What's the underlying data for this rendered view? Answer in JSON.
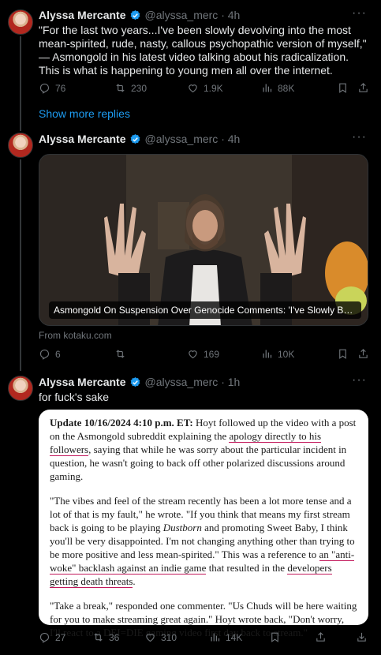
{
  "tweets": [
    {
      "author": "Alyssa Mercante",
      "handle": "@alyssa_merc",
      "time": "4h",
      "text": "\"For the last two years...I've been slowly devolving into the most mean-spirited, rude, nasty, callous psychopathic version of myself,\" — Asmongold in his latest video talking about his radicalization. This is what is happening to young men all over the internet.",
      "replies": "76",
      "reposts": "230",
      "likes": "1.9K",
      "views": "88K"
    },
    {
      "author": "Alyssa Mercante",
      "handle": "@alyssa_merc",
      "time": "4h",
      "media_caption": "Asmongold On Suspension Over Genocide Comments: 'I've Slowly Been Devolving...",
      "source": "From kotaku.com",
      "replies": "6",
      "reposts": "",
      "likes": "169",
      "views": "10K"
    },
    {
      "author": "Alyssa Mercante",
      "handle": "@alyssa_merc",
      "time": "1h",
      "text": "for fuck's sake",
      "replies": "27",
      "reposts": "36",
      "likes": "310",
      "views": "14K"
    }
  ],
  "show_more": "Show more replies",
  "article": {
    "p1_bold": "Update 10/16/2024 4:10 p.m. ET:",
    "p1_a": " Hoyt followed up the video with a post on the Asmongold subreddit explaining the ",
    "p1_link": "apology directly to his followers",
    "p1_b": ", saying that while he was sorry about the particular incident in question, he wasn't going to back off other polarized discussions around gaming.",
    "p2_a": "\"The vibes and feel of the stream recently has been a lot more tense and a lot of that is my fault,\" he wrote. \"If you think that means my first stream back is going to be playing ",
    "p2_italic": "Dustborn",
    "p2_b": " and promoting Sweet Baby, I think you'll be very disappointed. I'm not changing anything other than trying to be more positive and less mean-spirited.\" This was a reference to ",
    "p2_link1": "an \"anti-woke\" backlash against an indie game",
    "p2_c": " that resulted in the ",
    "p2_link2": "developers getting death threats",
    "p2_d": ".",
    "p3": "\"Take a break,\" responded one commenter. \"Us Chuds will be here waiting for you to make streaming great again.\" Hoyt wrote back, \"Don't worry, I'll react to a DEI=DIE gaming video first day back to stream.\""
  },
  "colors": {
    "accent": "#1d9bf0",
    "muted": "#71767b",
    "bg": "#000000",
    "link_underline": "#c2185b"
  }
}
